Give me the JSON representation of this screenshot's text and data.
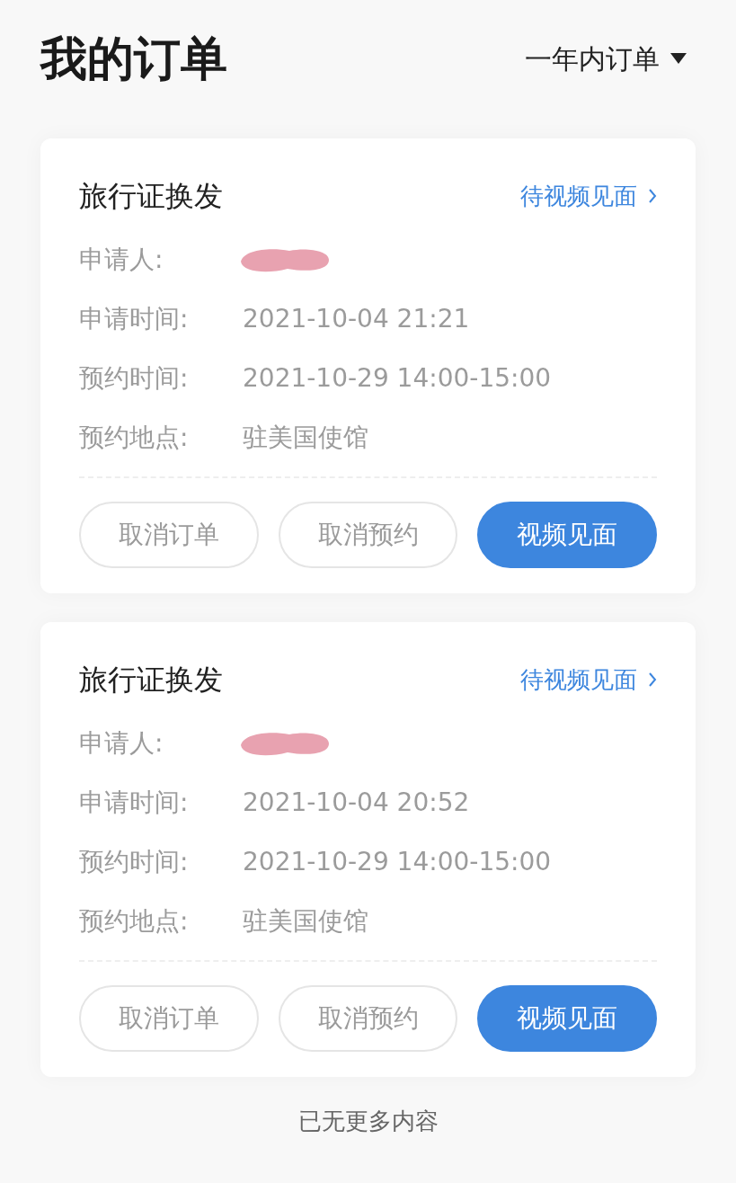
{
  "header": {
    "title": "我的订单",
    "filter": {
      "label": "一年内订单"
    }
  },
  "orders": [
    {
      "title": "旅行证换发",
      "status": "待视频见面",
      "fields": [
        {
          "label": "申请人:",
          "kind": "redacted"
        },
        {
          "label": "申请时间:",
          "value": "2021-10-04 21:21",
          "kind": "text"
        },
        {
          "label": "预约时间:",
          "value": "2021-10-29 14:00-15:00",
          "kind": "text"
        },
        {
          "label": "预约地点:",
          "value": "驻美国使馆",
          "kind": "text"
        }
      ],
      "buttons": [
        {
          "label": "取消订单",
          "kind": "outline"
        },
        {
          "label": "取消预约",
          "kind": "outline"
        },
        {
          "label": "视频见面",
          "kind": "primary"
        }
      ]
    },
    {
      "title": "旅行证换发",
      "status": "待视频见面",
      "fields": [
        {
          "label": "申请人:",
          "kind": "redacted"
        },
        {
          "label": "申请时间:",
          "value": "2021-10-04 20:52",
          "kind": "text"
        },
        {
          "label": "预约时间:",
          "value": "2021-10-29 14:00-15:00",
          "kind": "text"
        },
        {
          "label": "预约地点:",
          "value": "驻美国使馆",
          "kind": "text"
        }
      ],
      "buttons": [
        {
          "label": "取消订单",
          "kind": "outline"
        },
        {
          "label": "取消预约",
          "kind": "outline"
        },
        {
          "label": "视频见面",
          "kind": "primary"
        }
      ]
    }
  ],
  "footer": "已无更多内容"
}
